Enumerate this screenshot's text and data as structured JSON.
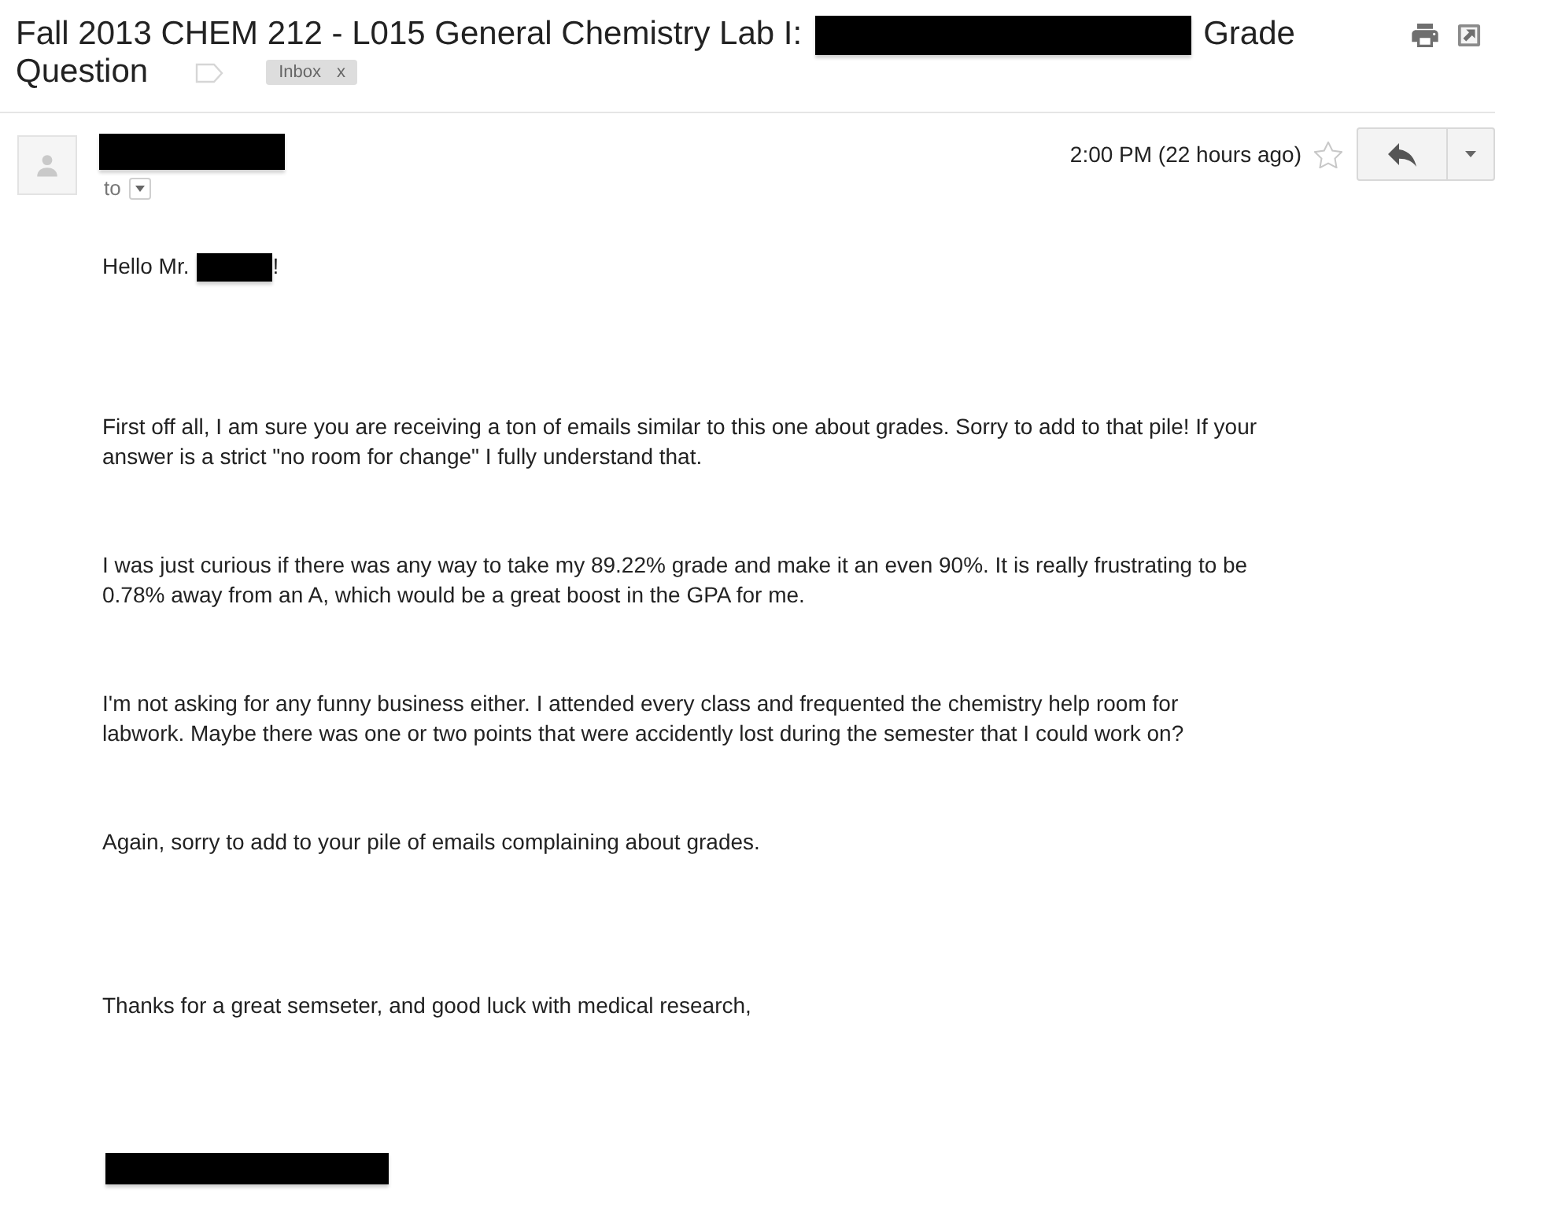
{
  "subject": {
    "lines": [
      [
        {
          "kind": "text",
          "text": "Fall 2013 CHEM 212 - L015 General Chemistry Lab I:"
        },
        {
          "kind": "redacted"
        },
        {
          "kind": "text",
          "text": "Grade"
        }
      ],
      [
        {
          "kind": "text",
          "text": "Question"
        }
      ]
    ]
  },
  "labels": [
    {
      "text": "Inbox",
      "remove": "x"
    }
  ],
  "message": {
    "sender": {
      "kind": "redacted"
    },
    "to_label": "to",
    "time": "2:00 PM (22 hours ago)",
    "starred": false
  },
  "body": [
    {
      "kind": "greeting",
      "parts": [
        {
          "kind": "text",
          "text": "Hello Mr."
        },
        {
          "kind": "redacted"
        },
        {
          "kind": "text",
          "text": "!"
        }
      ]
    },
    {
      "kind": "paragraph",
      "lines": [
        "First off all, I am sure you are receiving a ton of emails similar to this one about grades. Sorry to add to that pile! If your",
        "answer is a strict \"no room for change\" I fully understand that."
      ]
    },
    {
      "kind": "paragraph",
      "lines": [
        "I was just curious if there was any way to take my 89.22% grade and make it an even 90%. It is really frustrating to be",
        "0.78% away from an A, which would be a great boost in the GPA for me."
      ]
    },
    {
      "kind": "paragraph",
      "lines": [
        "I'm not asking for any funny business either. I attended every class and frequented the chemistry help room for",
        "labwork. Maybe there was one or two points that were accidently lost during the semester that I could work on?"
      ]
    },
    {
      "kind": "paragraph",
      "lines": [
        "Again, sorry to add to your pile of emails complaining about grades."
      ]
    },
    {
      "kind": "closing",
      "lines": [
        "Thanks for a great semseter, and good luck with medical research,"
      ]
    },
    {
      "kind": "redacted"
    }
  ]
}
